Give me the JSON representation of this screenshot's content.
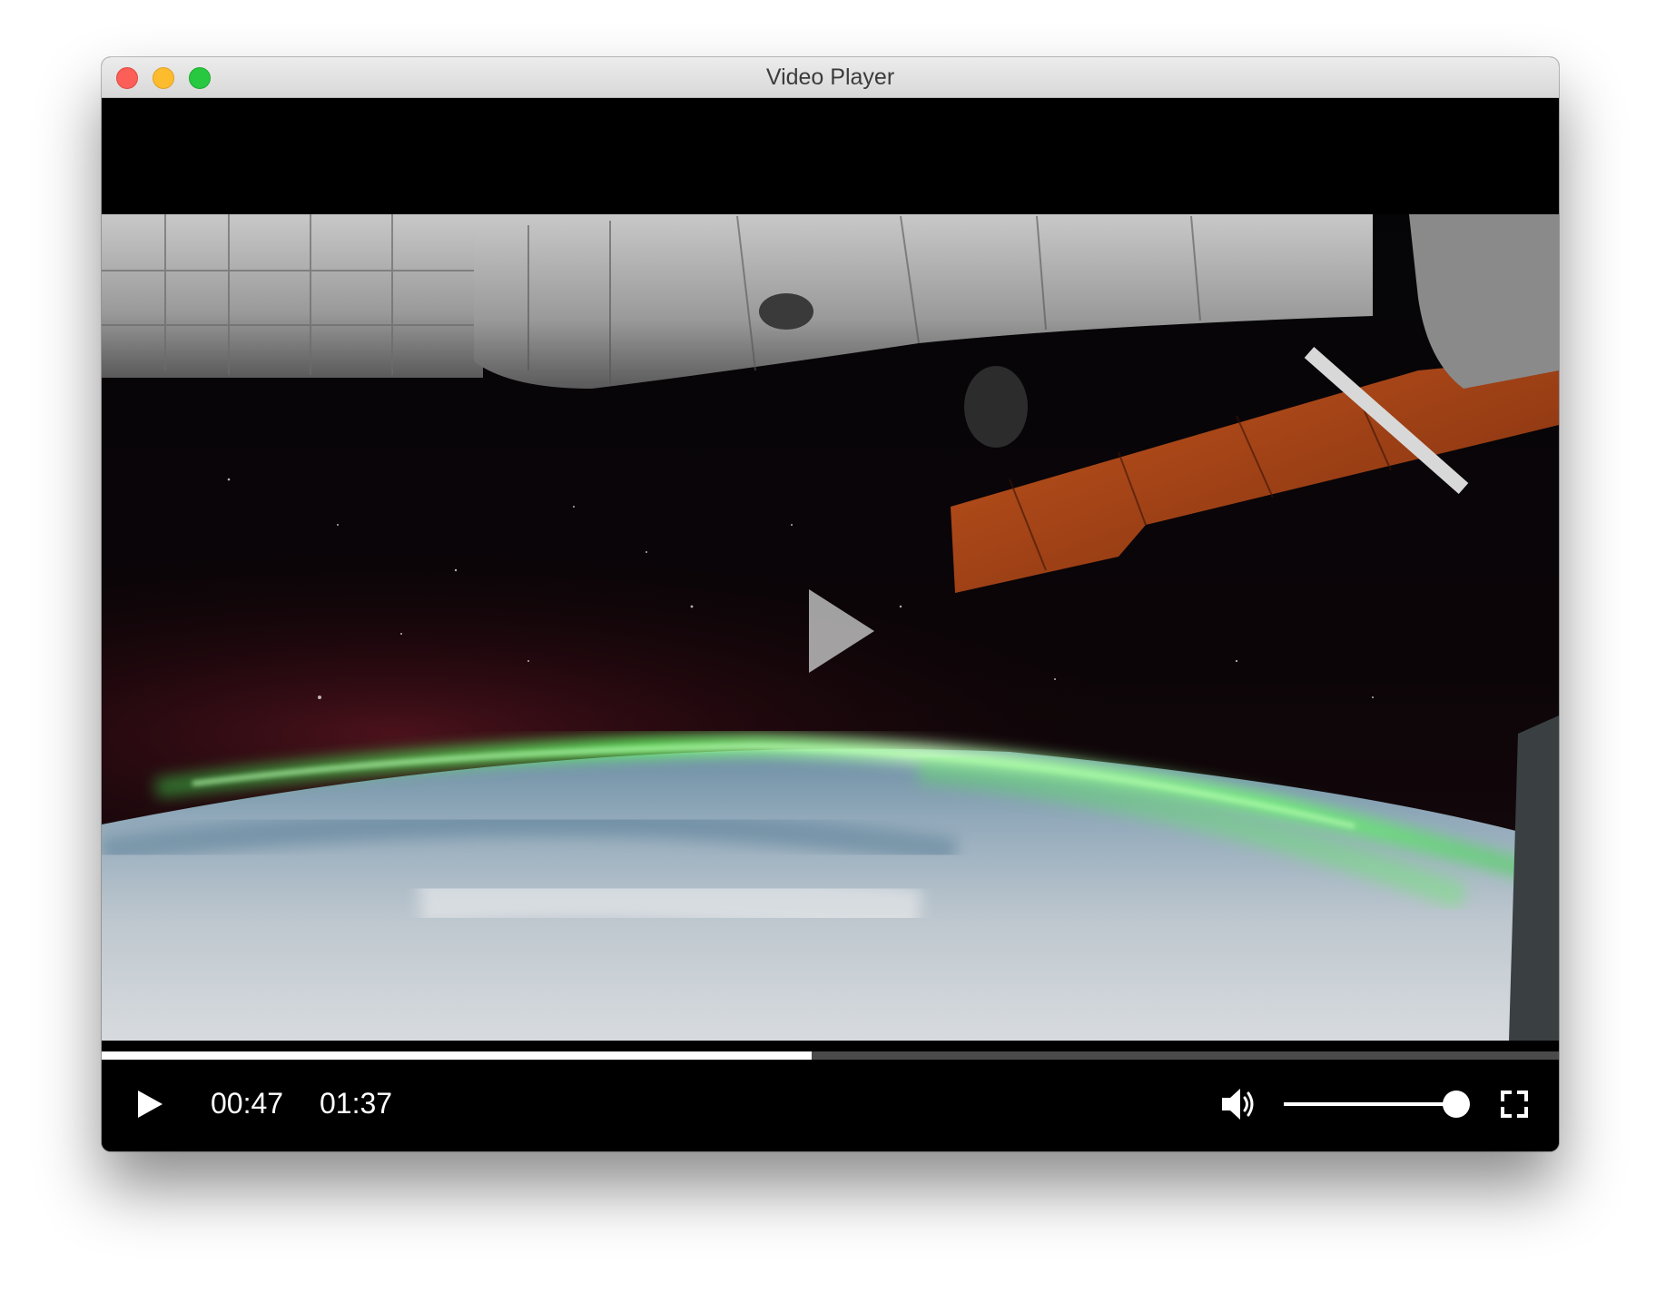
{
  "window": {
    "title": "Video Player"
  },
  "player": {
    "current_time": "00:47",
    "total_time": "01:37",
    "progress_fraction": 0.487,
    "volume_fraction": 1.0,
    "is_playing": false
  },
  "icons": {
    "center_play": "play-icon",
    "control_play": "play-icon",
    "volume": "speaker-volume-icon",
    "fullscreen": "fullscreen-icon"
  },
  "colors": {
    "close": "#fc5f57",
    "minimize": "#fdbc2e",
    "maximize": "#28c840",
    "progress_fill": "#ffffff",
    "progress_track": "#4a4a4a",
    "background": "#000000"
  }
}
